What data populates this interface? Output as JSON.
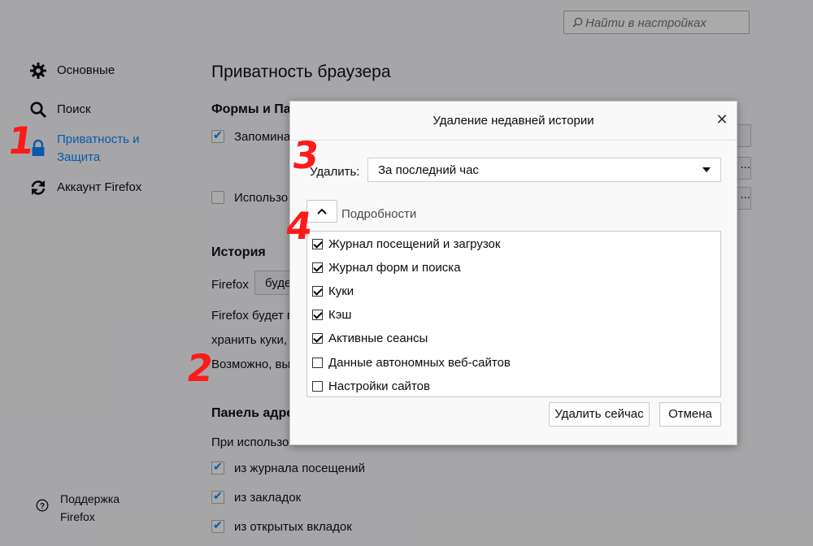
{
  "search": {
    "placeholder": "Найти в настройках"
  },
  "sidebar": {
    "items": [
      {
        "label": "Основные"
      },
      {
        "label": "Поиск"
      },
      {
        "label_line1": "Приватность и",
        "label_line2": "Защита"
      },
      {
        "label": "Аккаунт Firefox"
      }
    ],
    "support_line1": "Поддержка",
    "support_line2": "Firefox"
  },
  "main": {
    "title": "Приватность браузера",
    "forms_heading": "Формы и Па",
    "remember_label": "Запомина",
    "use_label": "Использо",
    "history_heading": "История",
    "firefox_label": "Firefox",
    "firefox_select": "буде",
    "history_text1": "Firefox будет п",
    "history_text2": "хранить куки,",
    "history_text3": "Возможно, вы",
    "addressbar_heading": "Панель адре",
    "addressbar_text": "При использо",
    "suggest_items": [
      {
        "label": "из журнала посещений",
        "checked": true
      },
      {
        "label": "из закладок",
        "checked": true
      },
      {
        "label": "из открытых вкладок",
        "checked": true
      }
    ],
    "btn_dots": "..."
  },
  "dialog": {
    "title": "Удаление недавней истории",
    "range_label": "Удалить:",
    "range_value": "За последний час",
    "details_label": "Подробности",
    "items": [
      {
        "label": "Журнал посещений и загрузок",
        "checked": true
      },
      {
        "label": "Журнал форм и поиска",
        "checked": true
      },
      {
        "label": "Куки",
        "checked": true
      },
      {
        "label": "Кэш",
        "checked": true
      },
      {
        "label": "Активные сеансы",
        "checked": true
      },
      {
        "label": "Данные автономных веб-сайтов",
        "checked": false
      },
      {
        "label": "Настройки сайтов",
        "checked": false
      }
    ],
    "clear_button": "Удалить сейчас",
    "cancel_button": "Отмена"
  },
  "markers": [
    "1",
    "2",
    "3",
    "4"
  ],
  "colors": {
    "accent": "#0a84ff",
    "marker": "#ff1a1a"
  }
}
